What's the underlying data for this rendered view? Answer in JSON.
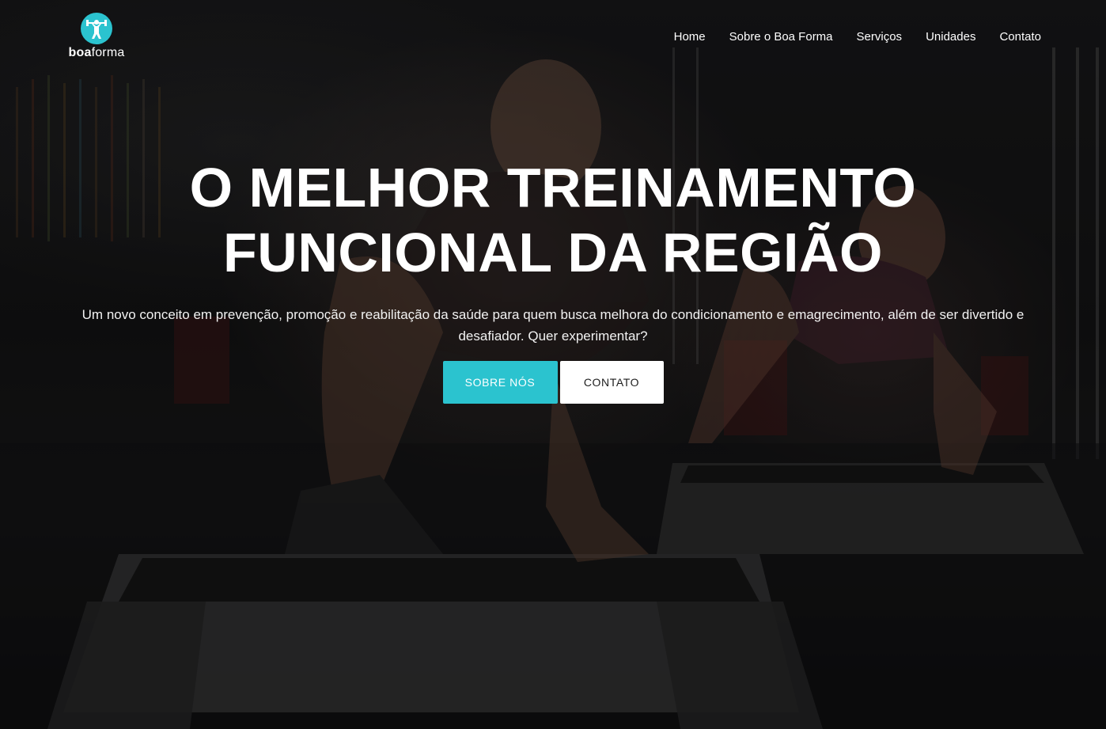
{
  "brand": {
    "name_bold": "boa",
    "name_light": "forma",
    "accent_color": "#2bc3cf",
    "icon": "weightlifter-icon"
  },
  "nav": {
    "items": [
      {
        "label": "Home"
      },
      {
        "label": "Sobre o Boa Forma"
      },
      {
        "label": "Serviços"
      },
      {
        "label": "Unidades"
      },
      {
        "label": "Contato"
      }
    ]
  },
  "hero": {
    "headline_line1": "O MELHOR TREINAMENTO",
    "headline_line2": "FUNCIONAL DA REGIÃO",
    "subtitle": "Um novo conceito em prevenção, promoção e reabilitação da saúde para quem busca melhora do condicionamento e emagrecimento, além de ser divertido e desafiador. Quer experimentar?",
    "primary_button": "SOBRE NÓS",
    "secondary_button": "CONTATO"
  }
}
